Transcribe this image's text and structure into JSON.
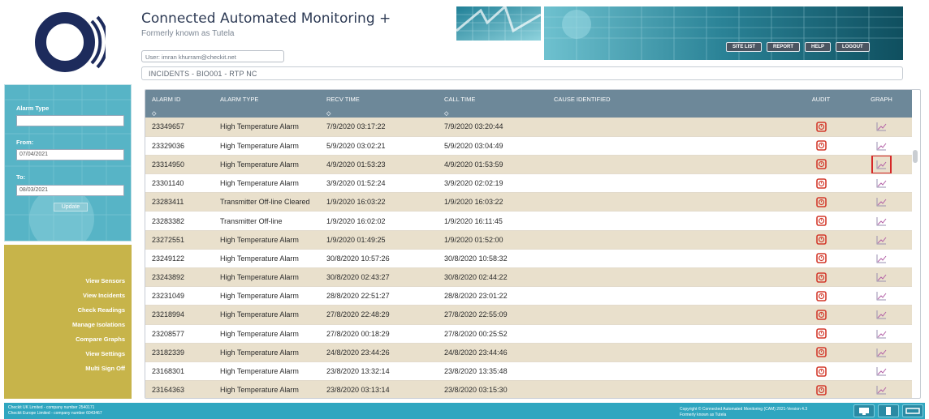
{
  "header": {
    "title": "Connected Automated Monitoring +",
    "subtitle": "Formerly known as Tutela",
    "user": "User: imran khurram@checkit.net",
    "breadcrumb": "INCIDENTS   -   BIO001 - RTP NC"
  },
  "top_nav": [
    {
      "label": "SITE LIST"
    },
    {
      "label": "REPORT"
    },
    {
      "label": "HELP"
    },
    {
      "label": "LOGOUT"
    }
  ],
  "filter": {
    "alarm_type_label": "Alarm Type",
    "alarm_type_value": "",
    "from_label": "From:",
    "from_value": "07/04/2021",
    "to_label": "To:",
    "to_value": "08/03/2021",
    "update_label": "Update"
  },
  "side_nav": [
    {
      "label": "View Sensors"
    },
    {
      "label": "View Incidents"
    },
    {
      "label": "Check Readings"
    },
    {
      "label": "Manage Isolations"
    },
    {
      "label": "Compare Graphs"
    },
    {
      "label": "View Settings"
    },
    {
      "label": "Multi Sign Off"
    }
  ],
  "table": {
    "columns": [
      "ALARM ID",
      "ALARM TYPE",
      "RECV TIME",
      "CALL TIME",
      "CAUSE IDENTIFIED",
      "AUDIT",
      "GRAPH"
    ],
    "sort_glyph": "◇",
    "rows": [
      {
        "id": "23349657",
        "type": "High Temperature Alarm",
        "recv": "7/9/2020 03:17:22",
        "call": "7/9/2020 03:20:44",
        "cause": ""
      },
      {
        "id": "23329036",
        "type": "High Temperature Alarm",
        "recv": "5/9/2020 03:02:21",
        "call": "5/9/2020 03:04:49",
        "cause": ""
      },
      {
        "id": "23314950",
        "type": "High Temperature Alarm",
        "recv": "4/9/2020 01:53:23",
        "call": "4/9/2020 01:53:59",
        "cause": ""
      },
      {
        "id": "23301140",
        "type": "High Temperature Alarm",
        "recv": "3/9/2020 01:52:24",
        "call": "3/9/2020 02:02:19",
        "cause": ""
      },
      {
        "id": "23283411",
        "type": "Transmitter Off-line Cleared",
        "recv": "1/9/2020 16:03:22",
        "call": "1/9/2020 16:03:22",
        "cause": ""
      },
      {
        "id": "23283382",
        "type": "Transmitter Off-line",
        "recv": "1/9/2020 16:02:02",
        "call": "1/9/2020 16:11:45",
        "cause": ""
      },
      {
        "id": "23272551",
        "type": "High Temperature Alarm",
        "recv": "1/9/2020 01:49:25",
        "call": "1/9/2020 01:52:00",
        "cause": ""
      },
      {
        "id": "23249122",
        "type": "High Temperature Alarm",
        "recv": "30/8/2020 10:57:26",
        "call": "30/8/2020 10:58:32",
        "cause": ""
      },
      {
        "id": "23243892",
        "type": "High Temperature Alarm",
        "recv": "30/8/2020 02:43:27",
        "call": "30/8/2020 02:44:22",
        "cause": ""
      },
      {
        "id": "23231049",
        "type": "High Temperature Alarm",
        "recv": "28/8/2020 22:51:27",
        "call": "28/8/2020 23:01:22",
        "cause": ""
      },
      {
        "id": "23218994",
        "type": "High Temperature Alarm",
        "recv": "27/8/2020 22:48:29",
        "call": "27/8/2020 22:55:09",
        "cause": ""
      },
      {
        "id": "23208577",
        "type": "High Temperature Alarm",
        "recv": "27/8/2020 00:18:29",
        "call": "27/8/2020 00:25:52",
        "cause": ""
      },
      {
        "id": "23182339",
        "type": "High Temperature Alarm",
        "recv": "24/8/2020 23:44:26",
        "call": "24/8/2020 23:44:46",
        "cause": ""
      },
      {
        "id": "23168301",
        "type": "High Temperature Alarm",
        "recv": "23/8/2020 13:32:14",
        "call": "23/8/2020 13:35:48",
        "cause": ""
      },
      {
        "id": "23164363",
        "type": "High Temperature Alarm",
        "recv": "23/8/2020 03:13:14",
        "call": "23/8/2020 03:15:30",
        "cause": ""
      }
    ],
    "highlighted_graph_row": 2
  },
  "footer": {
    "left_line1": "Checkit UK Limited - company number 2540171",
    "left_line2": "Checkit Europe Limited - company number 6043467",
    "right_line1": "Copyright © Connected Automated Monitoring (CAM) 2021-Version 4.3",
    "right_line2": "Formerly known as Tutela"
  },
  "colors": {
    "teal": "#57b4c6",
    "olive": "#c7b44a",
    "table_header": "#6d8899",
    "row_tan": "#e9e0cc",
    "audit_red": "#d33a2c",
    "highlight_red": "#d62828",
    "footer_blue": "#2fa6c0"
  },
  "icons": {
    "logo": "circle-logo",
    "audit": "clock-icon",
    "graph": "line-graph-icon",
    "footer": [
      "monitor-icon",
      "tablet-icon",
      "wide-screen-icon"
    ]
  }
}
